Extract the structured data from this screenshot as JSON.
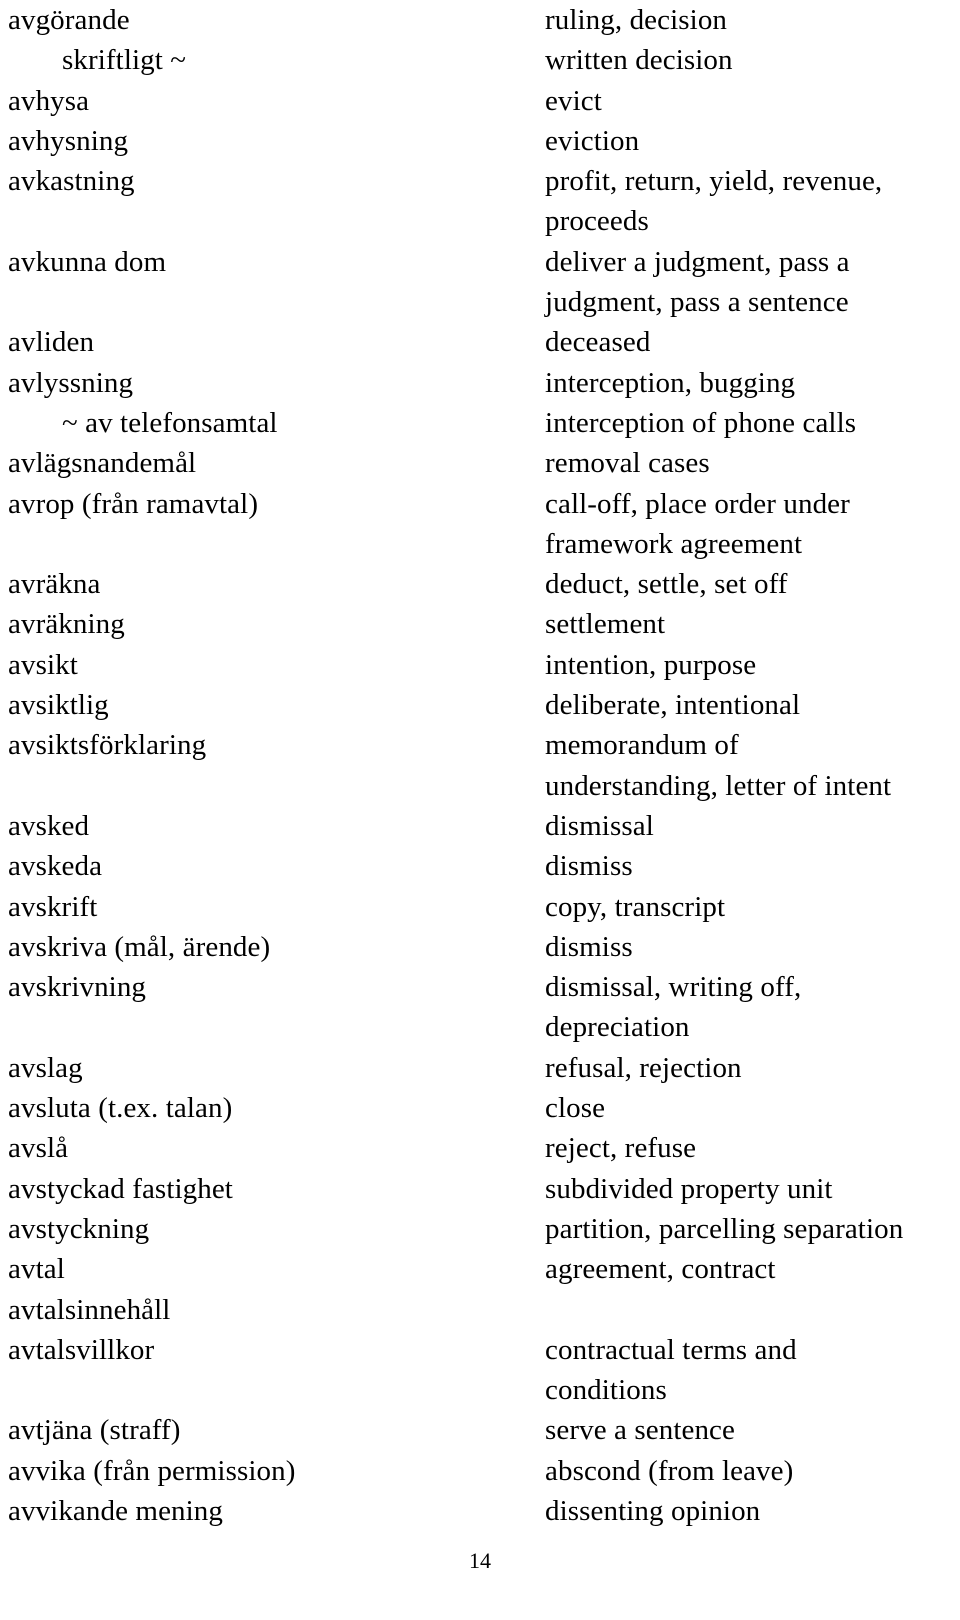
{
  "document": {
    "type": "swedish-english-legal-glossary",
    "page_number": "14",
    "columns": [
      "swedish",
      "english"
    ]
  },
  "rows": [
    {
      "sv": "avgörande",
      "en": "ruling, decision",
      "indent": false
    },
    {
      "sv": "skriftligt ~",
      "en": "written decision",
      "indent": true
    },
    {
      "sv": "avhysa",
      "en": "evict",
      "indent": false
    },
    {
      "sv": "avhysning",
      "en": "eviction",
      "indent": false
    },
    {
      "sv": "avkastning",
      "en": "profit, return, yield, revenue,",
      "indent": false
    },
    {
      "sv": "",
      "en": "proceeds",
      "indent": false
    },
    {
      "sv": "avkunna dom",
      "en": "deliver a judgment, pass a",
      "indent": false
    },
    {
      "sv": "",
      "en": "judgment, pass a sentence",
      "indent": false
    },
    {
      "sv": "avliden",
      "en": "deceased",
      "indent": false
    },
    {
      "sv": "avlyssning",
      "en": "interception, bugging",
      "indent": false
    },
    {
      "sv": "~ av telefonsamtal",
      "en": "interception of phone calls",
      "indent": true
    },
    {
      "sv": "avlägsnandemål",
      "en": "removal cases",
      "indent": false
    },
    {
      "sv": "avrop (från ramavtal)",
      "en": "call-off, place order under",
      "indent": false
    },
    {
      "sv": "",
      "en": "framework agreement",
      "indent": false
    },
    {
      "sv": "avräkna",
      "en": "deduct, settle, set off",
      "indent": false
    },
    {
      "sv": "avräkning",
      "en": "settlement",
      "indent": false
    },
    {
      "sv": "avsikt",
      "en": "intention, purpose",
      "indent": false
    },
    {
      "sv": "avsiktlig",
      "en": "deliberate, intentional",
      "indent": false
    },
    {
      "sv": "avsiktsförklaring",
      "en": "memorandum of",
      "indent": false
    },
    {
      "sv": "",
      "en": "understanding, letter of intent",
      "indent": false
    },
    {
      "sv": "avsked",
      "en": "dismissal",
      "indent": false
    },
    {
      "sv": "avskeda",
      "en": "dismiss",
      "indent": false
    },
    {
      "sv": "avskrift",
      "en": "copy, transcript",
      "indent": false
    },
    {
      "sv": "avskriva (mål, ärende)",
      "en": "dismiss",
      "indent": false
    },
    {
      "sv": "avskrivning",
      "en": "dismissal, writing off,",
      "indent": false
    },
    {
      "sv": "",
      "en": "depreciation",
      "indent": false
    },
    {
      "sv": "avslag",
      "en": "refusal, rejection",
      "indent": false
    },
    {
      "sv": "avsluta (t.ex. talan)",
      "en": "close",
      "indent": false
    },
    {
      "sv": "avslå",
      "en": "reject, refuse",
      "indent": false
    },
    {
      "sv": "avstyckad fastighet",
      "en": "subdivided property unit",
      "indent": false
    },
    {
      "sv": "avstyckning",
      "en": "partition, parcelling separation",
      "indent": false
    },
    {
      "sv": "avtal",
      "en": "agreement, contract",
      "indent": false
    },
    {
      "sv": "avtalsinnehåll",
      "en": "",
      "indent": false
    },
    {
      "sv": "avtalsvillkor",
      "en": "contractual terms and",
      "indent": false
    },
    {
      "sv": "",
      "en": "conditions",
      "indent": false
    },
    {
      "sv": "avtjäna (straff)",
      "en": "serve a sentence",
      "indent": false
    },
    {
      "sv": "avvika (från permission)",
      "en": "abscond (from leave)",
      "indent": false
    },
    {
      "sv": "avvikande mening",
      "en": "dissenting opinion",
      "indent": false
    }
  ]
}
